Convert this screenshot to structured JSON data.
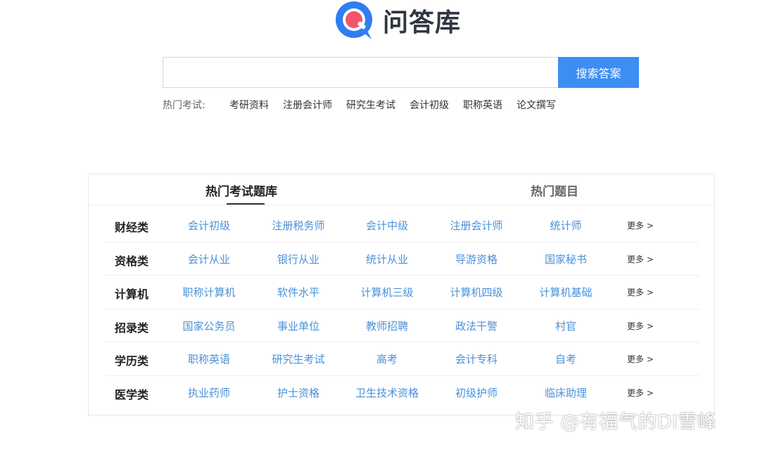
{
  "logo": {
    "mark_letter": "Q",
    "text": "问答库",
    "colors": {
      "blue": "#2f7ef0",
      "red": "#f0566a"
    }
  },
  "search": {
    "placeholder": "",
    "value": "",
    "button_label": "搜索答案"
  },
  "hot_exams": {
    "label": "热门考试:",
    "links": [
      "考研资料",
      "注册会计师",
      "研究生考试",
      "会计初级",
      "职称英语",
      "论文撰写"
    ]
  },
  "panel": {
    "tabs": [
      {
        "label": "热门考试题库",
        "active": true
      },
      {
        "label": "热门题目",
        "active": false
      }
    ],
    "more_label": "更多 >",
    "categories": [
      {
        "title": "财经类",
        "links": [
          "会计初级",
          "注册税务师",
          "会计中级",
          "注册会计师",
          "统计师"
        ]
      },
      {
        "title": "资格类",
        "links": [
          "会计从业",
          "银行从业",
          "统计从业",
          "导游资格",
          "国家秘书"
        ]
      },
      {
        "title": "计算机",
        "links": [
          "职称计算机",
          "软件水平",
          "计算机三级",
          "计算机四级",
          "计算机基础"
        ]
      },
      {
        "title": "招录类",
        "links": [
          "国家公务员",
          "事业单位",
          "教师招聘",
          "政法干警",
          "村官"
        ]
      },
      {
        "title": "学历类",
        "links": [
          "职称英语",
          "研究生考试",
          "高考",
          "会计专科",
          "自考"
        ]
      },
      {
        "title": "医学类",
        "links": [
          "执业药师",
          "护士资格",
          "卫生技术资格",
          "初级护师",
          "临床助理"
        ]
      }
    ]
  },
  "watermark": "知乎 @有福气的DI雪峰",
  "colors": {
    "accent": "#3d8ef2",
    "link": "#4a90d9"
  }
}
